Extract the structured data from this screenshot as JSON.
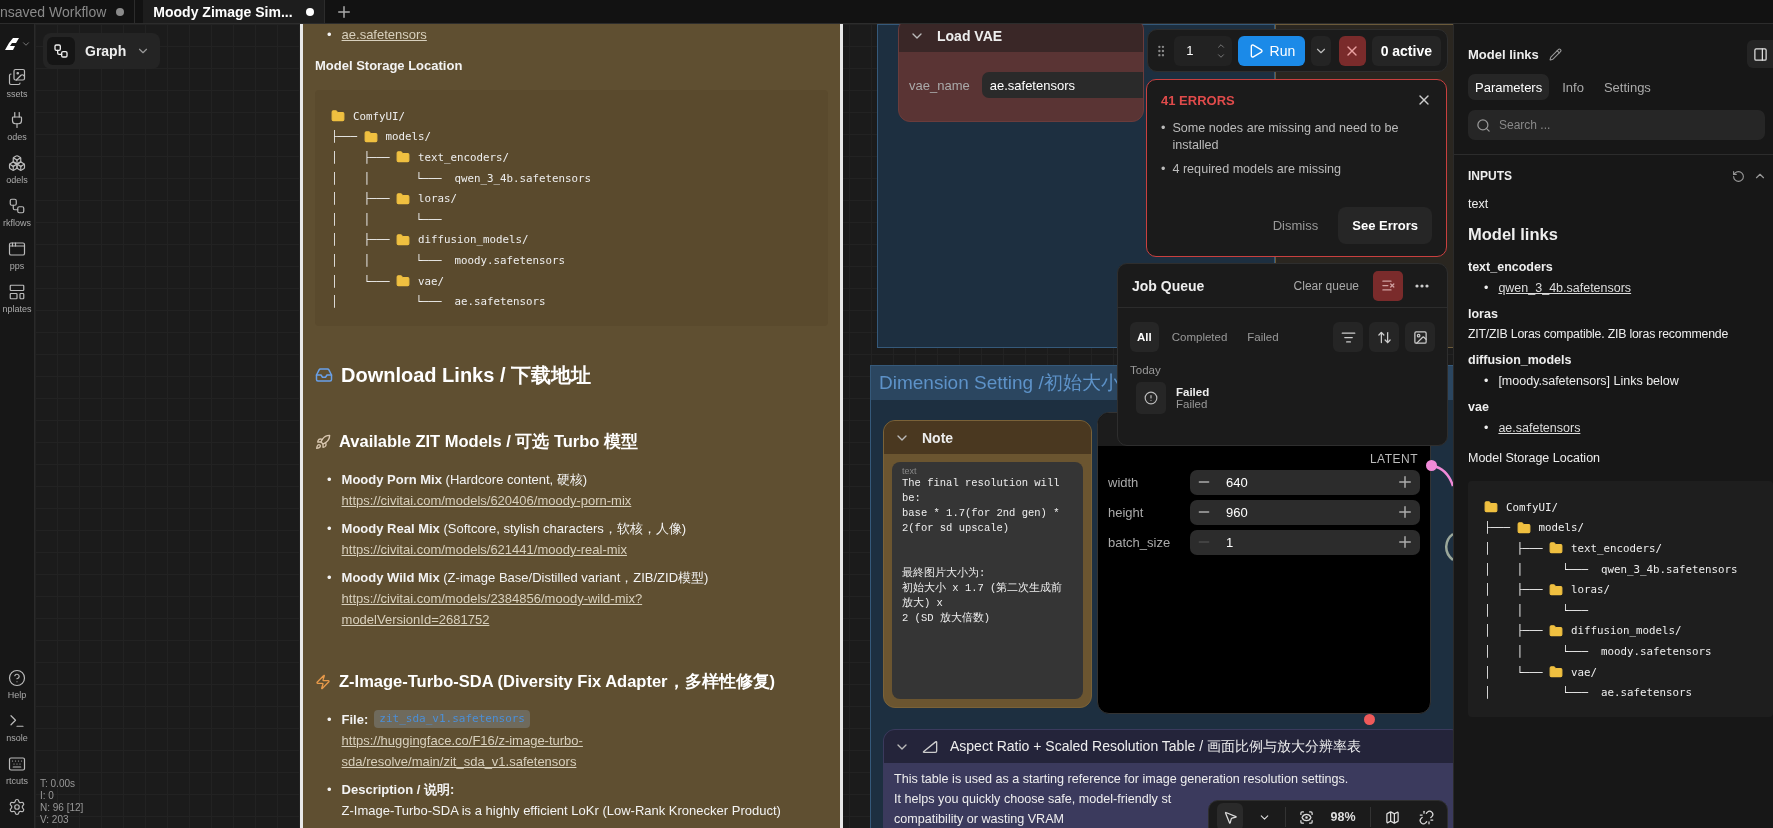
{
  "tabs": [
    {
      "label": "nsaved Workflow",
      "selected": false,
      "modified": true
    },
    {
      "label": "Moody Zimage Sim...",
      "selected": true,
      "modified": true
    }
  ],
  "rail": {
    "items": [
      {
        "kind": "assets",
        "label": "ssets"
      },
      {
        "kind": "nodes",
        "label": "odes"
      },
      {
        "kind": "models",
        "label": "odels"
      },
      {
        "kind": "workflows",
        "label": "rkflows"
      },
      {
        "kind": "apps",
        "label": "pps"
      },
      {
        "kind": "templates",
        "label": "nplates"
      }
    ],
    "bottom_items": [
      {
        "kind": "help",
        "label": "Help"
      },
      {
        "kind": "console",
        "label": "nsole"
      },
      {
        "kind": "shortcuts",
        "label": "rtcuts"
      },
      {
        "kind": "settings"
      }
    ]
  },
  "canvas": {
    "view_button": "Graph",
    "stats": [
      "T: 0.00s",
      "I: 0",
      "N: 96 [12]",
      "V: 203"
    ]
  },
  "note_panel": {
    "bullet": "•",
    "top_link": "ae.safetensors",
    "storage_title": "Model Storage Location",
    "tree": [
      {
        "kind": "folder",
        "name": "ComfyUI/"
      },
      {
        "prefix": "├─── ",
        "kind": "folder",
        "name": "models/"
      },
      {
        "prefix": "│    ├─── ",
        "kind": "folder",
        "name": "text_encoders/"
      },
      {
        "prefix": "│    │       └───  ",
        "kind": "file",
        "name": "qwen_3_4b.safetensors"
      },
      {
        "prefix": "│    ├─── ",
        "kind": "folder",
        "name": "loras/"
      },
      {
        "prefix": "│    │       └───",
        "kind": "file"
      },
      {
        "prefix": "│    ├─── ",
        "kind": "folder",
        "name": "diffusion_models/"
      },
      {
        "prefix": "│    │       └───  ",
        "kind": "file",
        "name": "moody.safetensors"
      },
      {
        "prefix": "│    └─── ",
        "kind": "folder",
        "name": "vae/"
      },
      {
        "prefix": "│            └───  ",
        "kind": "file",
        "name": "ae.safetensors"
      }
    ],
    "sections": [
      {
        "heading": "Download Links / 下载地址"
      },
      {
        "heading": "Available ZIT Models / 可选 Turbo 模型",
        "items": [
          {
            "kind": "model",
            "label": "**Moody Porn Mix** (Hardcore content, 硬核)",
            "link": "https://civitai.com/models/620406/moody-porn-mix"
          },
          {
            "kind": "model",
            "label": "**Moody Real Mix** (Softcore, stylish characters，软核，人像)",
            "link": "https://civitai.com/models/621441/moody-real-mix"
          },
          {
            "kind": "model",
            "label": "**Moody Wild Mix** (Z-image Base/Distilled variant，ZIB/ZID模型)",
            "link": "https://civitai.com/models/2384856/moody-wild-mix?modelVersionId=2681752"
          }
        ]
      },
      {
        "heading": "Z-Image-Turbo-SDA (Diversity Fix Adapter，多样性修复)",
        "items": [
          {
            "kind": "file",
            "label": "File:",
            "code": "zit_sda_v1.safetensors",
            "link": "https://huggingface.co/F16/z-image-turbo-sda/resolve/main/zit_sda_v1.safetensors"
          },
          {
            "kind": "description",
            "label": "Description / 说明:",
            "text": "Z-Image-Turbo-SDA is a highly efficient LoKr (Low-Rank Kronecker Product)"
          }
        ]
      }
    ]
  },
  "load_vae": {
    "title": "Load VAE",
    "widget_label": "vae_name",
    "widget_value": "ae.safetensors"
  },
  "run_toolbar": {
    "count": "1",
    "run": "Run",
    "active": "0 active"
  },
  "errors": {
    "title": "41 ERRORS",
    "bullet": "•",
    "messages": [
      "Some nodes are missing and need to be installed",
      "4 required models are missing"
    ],
    "dismiss": "Dismiss",
    "action": "See Errors"
  },
  "job_queue": {
    "title": "Job Queue",
    "clear": "Clear queue",
    "filters": [
      {
        "label": "All",
        "selected": true
      },
      {
        "label": "Completed",
        "selected": false
      },
      {
        "label": "Failed",
        "selected": false
      }
    ],
    "section": "Today",
    "jobs": [
      {
        "title": "Failed",
        "status": "Failed"
      }
    ]
  },
  "dimension_group": {
    "title": "Dimension Setting /初始大小"
  },
  "note_node": {
    "title": "Note",
    "field_label": "text",
    "text": "The final resolution will be:\nbase * 1.7(for 2nd gen) * 2(for sd upscale)\n\n\n最終图片大小为:\n初始大小 x 1.7 (第二次生成前放大) x\n2 (SD 放大倍数)"
  },
  "latent_node": {
    "output": "LATENT",
    "widgets": [
      {
        "label": "width",
        "value": "640",
        "at_min": false
      },
      {
        "label": "height",
        "value": "960",
        "at_min": false
      },
      {
        "label": "batch_size",
        "value": "1",
        "at_min": true
      }
    ]
  },
  "aspect_node": {
    "title": "Aspect Ratio + Scaled Resolution Table / 画面比例与放大分辨率表",
    "lines": [
      "This table is used as a starting reference for image generation resolution settings.",
      "It helps you quickly choose safe, model-friendly st",
      "compatibility or wasting VRAM"
    ]
  },
  "canvas_toolbar": {
    "zoom": "98%"
  },
  "right_panel": {
    "title": "Model links",
    "bullet": "•",
    "tabs": [
      {
        "label": "Parameters",
        "selected": true
      },
      {
        "label": "Info",
        "selected": false
      },
      {
        "label": "Settings",
        "selected": false
      }
    ],
    "search": {
      "placeholder": "Search ..."
    },
    "section_title": "INPUTS",
    "field_label": "text",
    "heading": "Model links",
    "groups": [
      {
        "title": "text_encoders",
        "bullets": [
          {
            "text": "qwen_3_4b.safetensors",
            "link": true
          }
        ]
      },
      {
        "title": "loras",
        "paragraph": "ZIT/ZIB Loras compatible. ZIB loras recommende"
      },
      {
        "title": "diffusion_models",
        "bullets": [
          {
            "text": "[moody.safetensors] Links below",
            "link": false
          }
        ]
      },
      {
        "title": "vae",
        "bullets": [
          {
            "text": "ae.safetensors",
            "link": true
          }
        ]
      }
    ],
    "storage_title": "Model Storage Location",
    "tree": [
      {
        "kind": "folder",
        "name": "ComfyUI/"
      },
      {
        "prefix": "├─── ",
        "kind": "folder",
        "name": "models/"
      },
      {
        "prefix": "│    ├─── ",
        "kind": "folder",
        "name": "text_encoders/"
      },
      {
        "prefix": "│    │      └───  ",
        "kind": "file",
        "name": "qwen_3_4b.safetensors"
      },
      {
        "prefix": "│    ├─── ",
        "kind": "folder",
        "name": "loras/"
      },
      {
        "prefix": "│    │      └───",
        "kind": "file"
      },
      {
        "prefix": "│    ├─── ",
        "kind": "folder",
        "name": "diffusion_models/"
      },
      {
        "prefix": "│    │      └───  ",
        "kind": "file",
        "name": "moody.safetensors"
      },
      {
        "prefix": "│    └─── ",
        "kind": "folder",
        "name": "vae/"
      },
      {
        "prefix": "│           └───  ",
        "kind": "file",
        "name": "ae.safetensors"
      }
    ]
  }
}
